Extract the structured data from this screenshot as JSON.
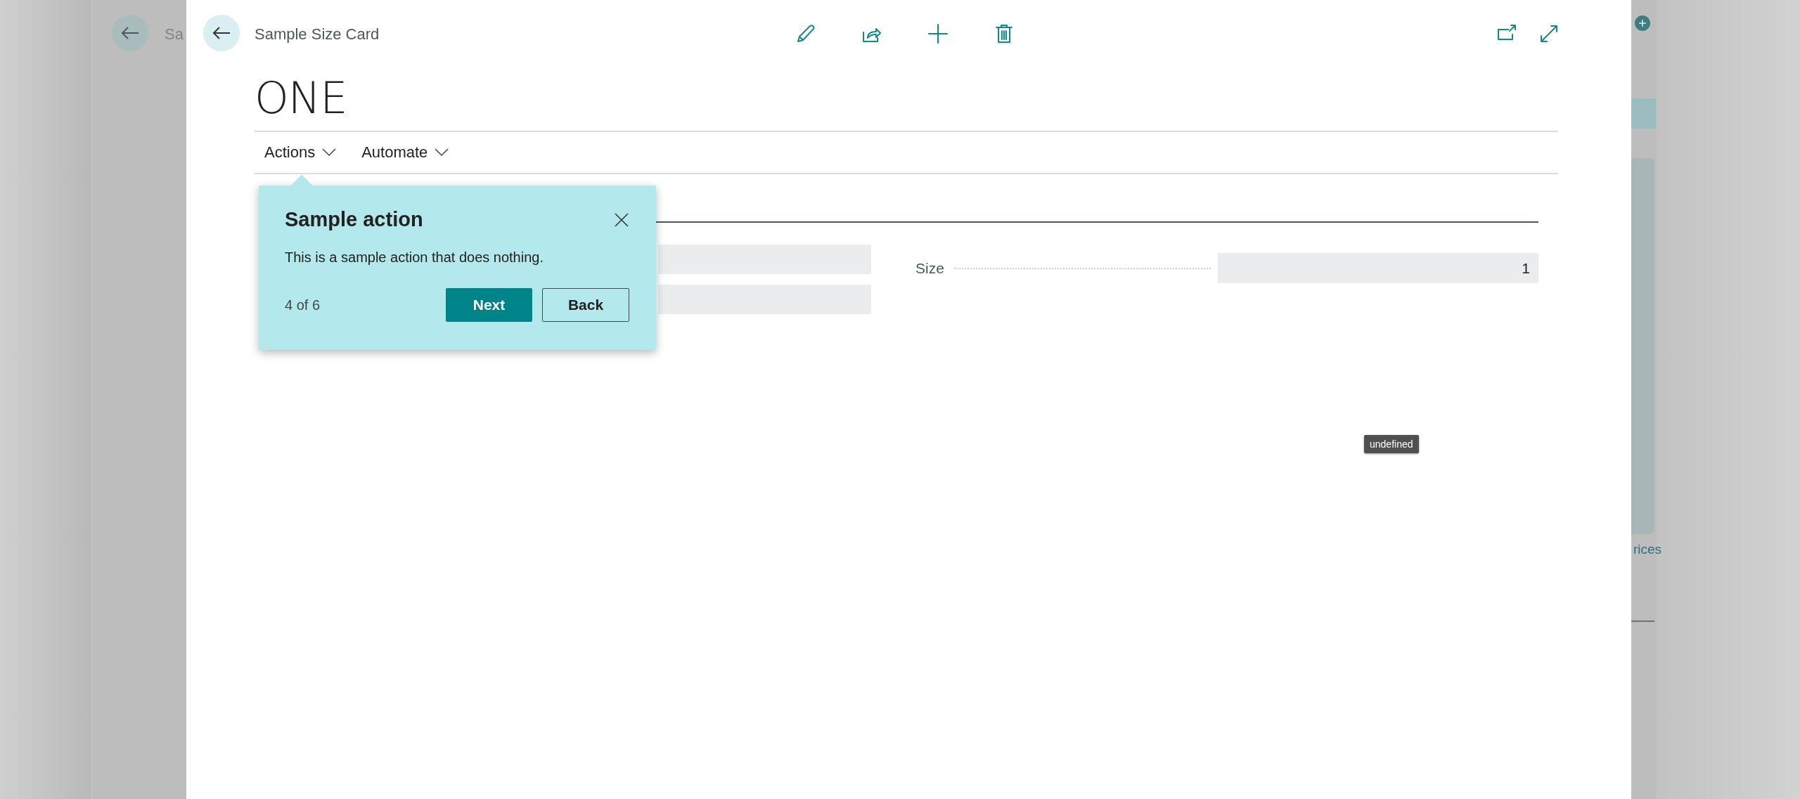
{
  "background_page": {
    "title_fragment": "Sa",
    "link_fragment": "rices"
  },
  "dialog": {
    "breadcrumb": "Sample Size Card",
    "title": "ONE",
    "action_bar": [
      {
        "label": "Actions"
      },
      {
        "label": "Automate"
      }
    ],
    "fields": [
      {
        "label": "Size",
        "value": "1"
      }
    ]
  },
  "teaching_tip": {
    "title": "Sample action",
    "text": "This is a sample action that does nothing.",
    "progress": "4 of 6",
    "buttons": [
      {
        "label": "Next",
        "kind": "primary"
      },
      {
        "label": "Back",
        "kind": "secondary"
      }
    ]
  },
  "tooltip": "undefined"
}
